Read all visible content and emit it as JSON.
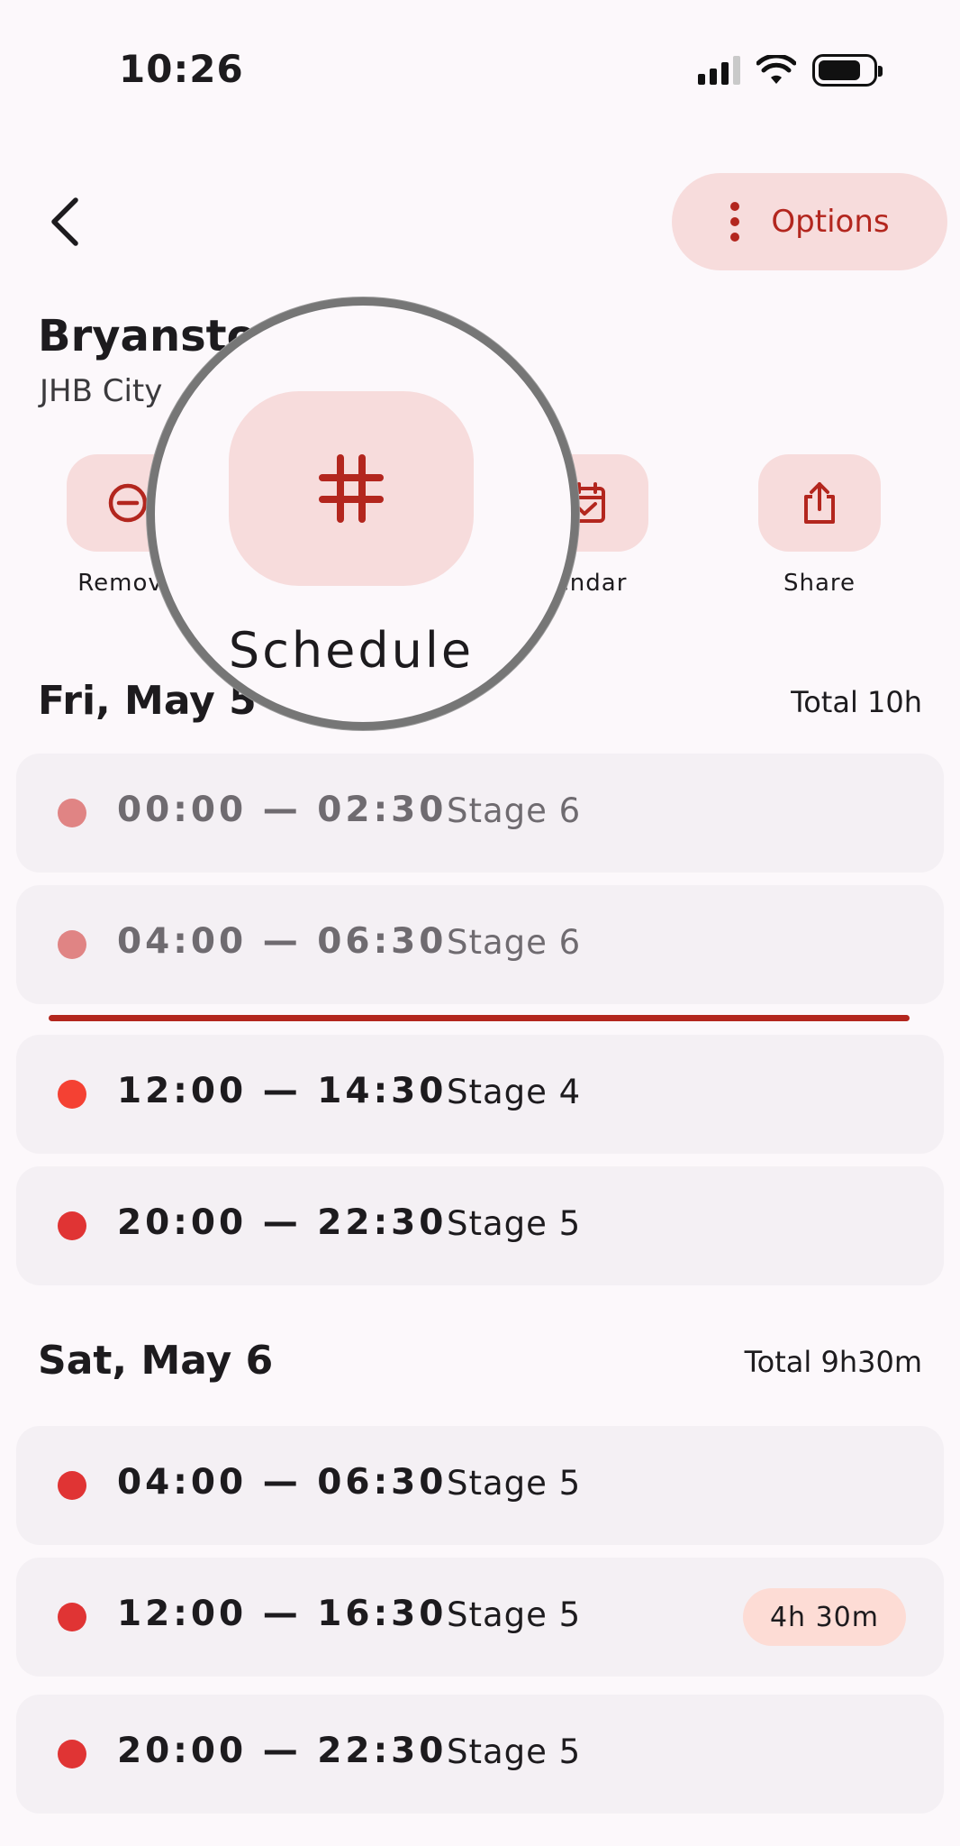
{
  "status": {
    "time": "10:26"
  },
  "header": {
    "options_label": "Options"
  },
  "area": {
    "title": "Bryanston",
    "subtitle": "JHB City"
  },
  "actions": [
    {
      "label": "Remove"
    },
    {
      "label": "Schedule"
    },
    {
      "label": "lendar"
    },
    {
      "label": "Share"
    }
  ],
  "days": [
    {
      "title": "Fri, May 5",
      "total": "Total 10h",
      "slots": [
        {
          "time": "00:00 — 02:30",
          "stage": "Stage 6",
          "state": "past"
        },
        {
          "time": "04:00 — 06:30",
          "stage": "Stage 6",
          "state": "past"
        },
        {
          "time": "12:00 — 14:30",
          "stage": "Stage 4",
          "state": "current"
        },
        {
          "time": "20:00 — 22:30",
          "stage": "Stage 5",
          "state": "upcoming"
        }
      ]
    },
    {
      "title": "Sat, May 6",
      "total": "Total 9h30m",
      "slots": [
        {
          "time": "04:00 — 06:30",
          "stage": "Stage 5",
          "state": "upcoming"
        },
        {
          "time": "12:00 — 16:30",
          "stage": "Stage 5",
          "state": "upcoming",
          "badge": "4h 30m"
        },
        {
          "time": "20:00 — 22:30",
          "stage": "Stage 5",
          "state": "upcoming"
        }
      ]
    }
  ],
  "colors": {
    "accent": "#b3261e",
    "pill_bg": "#f7dcdc",
    "slot_bg": "#f4f0f4",
    "dot": "#e03434"
  },
  "icons": [
    "back-arrow-icon",
    "more-vert-icon",
    "remove-circle-icon",
    "hashtag-icon",
    "calendar-check-icon",
    "share-icon",
    "wifi-icon",
    "battery-icon",
    "signal-icon"
  ]
}
